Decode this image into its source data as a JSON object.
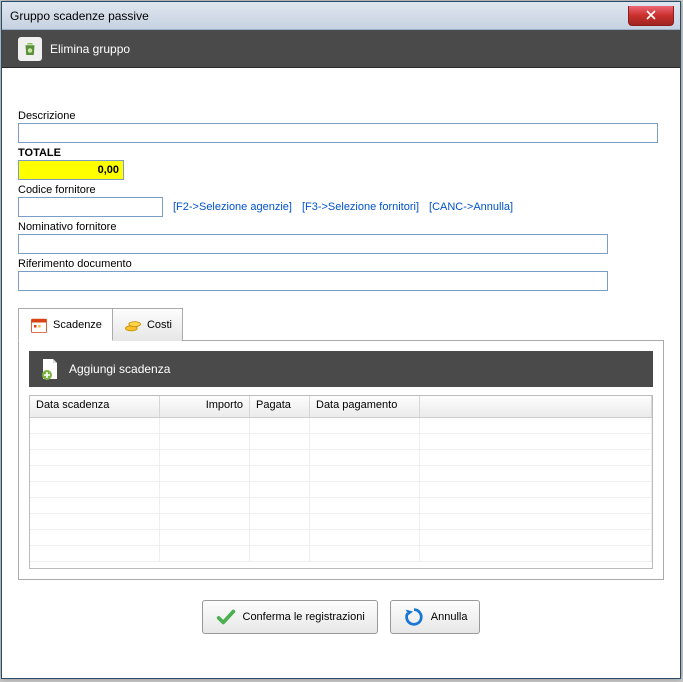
{
  "window": {
    "title": "Gruppo scadenze passive"
  },
  "toolbar": {
    "delete_group": "Elimina gruppo"
  },
  "fields": {
    "descrizione": {
      "label": "Descrizione",
      "value": ""
    },
    "totale": {
      "label": "TOTALE",
      "value": "0,00"
    },
    "codice_fornitore": {
      "label": "Codice fornitore",
      "value": ""
    },
    "nominativo_fornitore": {
      "label": "Nominativo fornitore",
      "value": ""
    },
    "riferimento_documento": {
      "label": "Riferimento documento",
      "value": ""
    }
  },
  "fkeys": {
    "f2": "[F2->Selezione agenzie]",
    "f3": "[F3->Selezione fornitori]",
    "canc": "[CANC->Annulla]"
  },
  "tabs": {
    "scadenze": "Scadenze",
    "costi": "Costi"
  },
  "subtoolbar": {
    "add": "Aggiungi scadenza"
  },
  "grid": {
    "columns": [
      "Data scadenza",
      "Importo",
      "Pagata",
      "Data pagamento",
      ""
    ],
    "rows": []
  },
  "footer": {
    "confirm": "Conferma le registrazioni",
    "cancel": "Annulla"
  }
}
